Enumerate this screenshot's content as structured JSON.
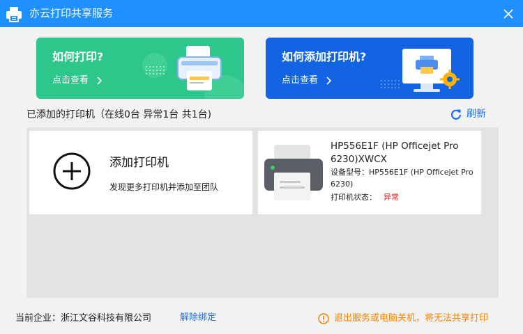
{
  "window": {
    "title": "亦云打印共享服务",
    "close_icon": "close-icon",
    "app_icon": "printer-logo-icon",
    "titlebar_color": "#1e90ff"
  },
  "banners": [
    {
      "title": "如何打印?",
      "link": "点击查看",
      "color": "#2dc68b"
    },
    {
      "title": "如何添加打印机?",
      "link": "点击查看",
      "color": "#1264e2"
    }
  ],
  "printers_section": {
    "title": "已添加的打印机（在线0台 异常1台 共1台)",
    "refresh_label": "刷新"
  },
  "add_card": {
    "title": "添加打印机",
    "description": "发现更多打印机并添加至团队"
  },
  "printer_card": {
    "name": "HP556E1F (HP Officejet Pro 6230)XWCX",
    "model_label": "设备型号：",
    "model_value": "HP556E1F (HP Officejet Pro 6230)",
    "status_label": "打印机状态：",
    "status_value": "异常",
    "status_color": "#d21f1f"
  },
  "footer": {
    "company": "当前企业：浙江文谷科技有限公司",
    "unbind_label": "解除绑定",
    "warning": "退出服务或电脑关机，将无法共享打印",
    "warning_color": "#f08300"
  }
}
